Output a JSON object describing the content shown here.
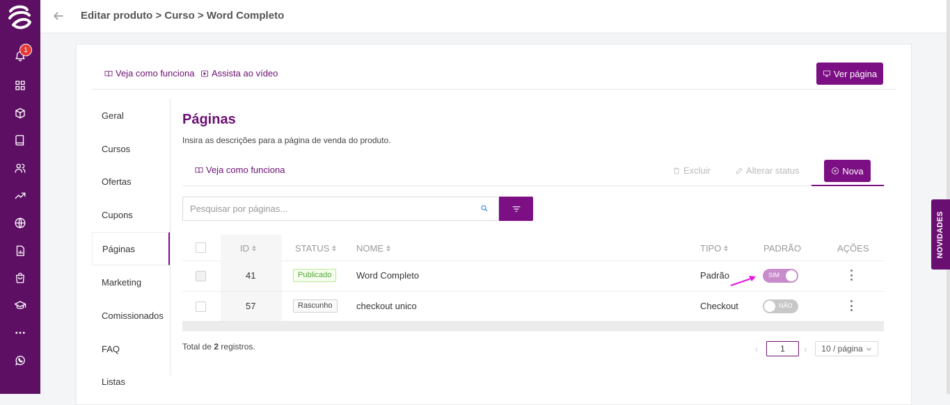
{
  "notifications": {
    "count": "1"
  },
  "header": {
    "breadcrumb": "Editar produto > Curso > Word Completo"
  },
  "links": {
    "how_it_works": "Veja como funciona",
    "watch_video": "Assista ao vídeo",
    "view_page": "Ver página"
  },
  "sidenav": [
    "Geral",
    "Cursos",
    "Ofertas",
    "Cupons",
    "Páginas",
    "Marketing",
    "Comissionados",
    "FAQ",
    "Listas"
  ],
  "section": {
    "title": "Páginas",
    "subtitle": "Insira as descrições para a página de venda do produto.",
    "how_it_works": "Veja como funciona",
    "delete": "Excluir",
    "change_status": "Alterar status",
    "new": "Nova"
  },
  "search": {
    "placeholder": "Pesquisar por páginas..."
  },
  "table": {
    "headers": {
      "id": "ID",
      "status": "STATUS",
      "name": "NOME",
      "type": "TIPO",
      "default": "PADRÃO",
      "actions": "AÇÕES"
    },
    "rows": [
      {
        "id": "41",
        "status": "Publicado",
        "name": "Word Completo",
        "type": "Padrão",
        "default": "SIM"
      },
      {
        "id": "57",
        "status": "Rascunho",
        "name": "checkout unico",
        "type": "Checkout",
        "default": "NÃO"
      }
    ]
  },
  "footer": {
    "total_prefix": "Total de ",
    "total_count": "2",
    "total_suffix": " registros.",
    "page": "1",
    "per_page": "10 / página"
  },
  "side_tab": "NOVIDADES",
  "colors": {
    "brand": "#7b0f83",
    "rail": "#5c0f63",
    "published": "#52a43a",
    "switch_on": "#c88ccc",
    "arrow": "#e514e0"
  }
}
